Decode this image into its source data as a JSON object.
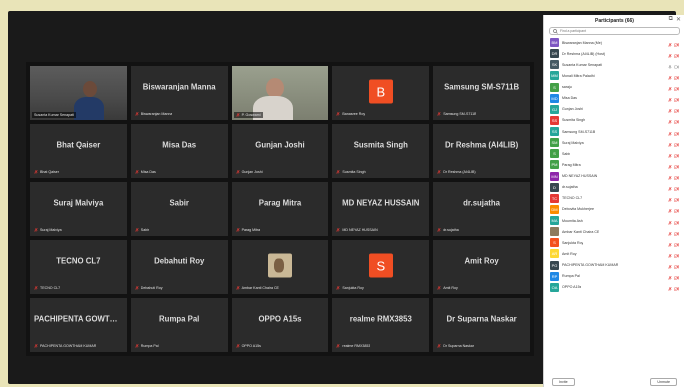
{
  "panel": {
    "title": "Participants (66)",
    "search_placeholder": "Find a participant",
    "invite_label": "Invite",
    "unmute_label": "Unmute",
    "participants": [
      {
        "initials": "BM",
        "color": "#7e57c2",
        "name": "Biswaranjan Manna (Me)",
        "mic": "muted",
        "video": "off"
      },
      {
        "initials": "DR",
        "color": "#37474f",
        "name": "Dr Reshma (AI4LIB) (Host)",
        "mic": "muted",
        "video": "off"
      },
      {
        "initials": "SK",
        "color": "#455a64",
        "name": "Susanta Kumar Senapati",
        "mic": "on",
        "video": "on"
      },
      {
        "initials": "MM",
        "color": "#26a69a",
        "name": "Monali Mitra Paladhi",
        "mic": "muted",
        "video": "off"
      },
      {
        "initials": "S",
        "color": "#43a047",
        "name": "saraju",
        "mic": "muted",
        "video": "off"
      },
      {
        "initials": "MD",
        "color": "#1e88e5",
        "name": "Misa Das",
        "mic": "muted",
        "video": "off"
      },
      {
        "initials": "GJ",
        "color": "#26a69a",
        "name": "Gunjan Joshi",
        "mic": "muted",
        "video": "off"
      },
      {
        "initials": "SS",
        "color": "#e53935",
        "name": "Susmita Singh",
        "mic": "muted",
        "video": "off"
      },
      {
        "initials": "SS",
        "color": "#26a69a",
        "name": "Samsung SM-S711B",
        "mic": "muted",
        "video": "off"
      },
      {
        "initials": "SM",
        "color": "#43a047",
        "name": "Suraj Malviya",
        "mic": "muted",
        "video": "off"
      },
      {
        "initials": "S",
        "color": "#43a047",
        "name": "Sabir",
        "mic": "muted",
        "video": "off"
      },
      {
        "initials": "PM",
        "color": "#43a047",
        "name": "Parag Mitra",
        "mic": "muted",
        "video": "off"
      },
      {
        "initials": "MN",
        "color": "#8e24aa",
        "name": "MD NEYAZ HUSSAIN",
        "mic": "muted",
        "video": "off"
      },
      {
        "initials": "D",
        "color": "#37474f",
        "name": "dr.sujatha",
        "mic": "muted",
        "video": "off"
      },
      {
        "initials": "TC",
        "color": "#e53935",
        "name": "TECNO CL7",
        "mic": "muted",
        "video": "off"
      },
      {
        "initials": "DM",
        "color": "#fb8c00",
        "name": "Debovita Mukherjee",
        "mic": "muted",
        "video": "off"
      },
      {
        "initials": "MA",
        "color": "#26a69a",
        "name": "Moumita Ash",
        "mic": "muted",
        "video": "off"
      },
      {
        "initials": "",
        "color": "#8d7b5e",
        "name": "Ambar Kanti Chaira CE",
        "mic": "muted",
        "video": "off"
      },
      {
        "initials": "S",
        "color": "#f4511e",
        "name": "Sanjukta Roy",
        "mic": "muted",
        "video": "off"
      },
      {
        "initials": "AR",
        "color": "#fdd835",
        "name": "Amit Roy",
        "mic": "muted",
        "video": "off"
      },
      {
        "initials": "PG",
        "color": "#37474f",
        "name": "PACHIPENTA GOWTHAM KUMAR",
        "mic": "muted",
        "video": "off"
      },
      {
        "initials": "RP",
        "color": "#1e88e5",
        "name": "Rumpa Pal",
        "mic": "muted",
        "video": "off"
      },
      {
        "initials": "OA",
        "color": "#26a69a",
        "name": "OPPO A15s",
        "mic": "muted",
        "video": "off"
      }
    ]
  },
  "tiles": [
    {
      "type": "video",
      "variant": "vid1",
      "display": "",
      "label": "Susanta Kumar Senapati",
      "muted": false
    },
    {
      "type": "name",
      "display": "Biswaranjan Manna",
      "label": "Biswaranjan Manna",
      "muted": true
    },
    {
      "type": "video",
      "variant": "vid2",
      "display": "",
      "label": "P. Goswami",
      "muted": true
    },
    {
      "type": "avatar",
      "letter": "B",
      "display": "",
      "label": "Banasree Roy",
      "muted": true
    },
    {
      "type": "name",
      "display": "Samsung SM-S711B",
      "label": "Samsung SM-S711B",
      "muted": true
    },
    {
      "type": "name",
      "display": "Bhat Qaiser",
      "label": "Bhat Qaiser",
      "muted": true
    },
    {
      "type": "name",
      "display": "Misa Das",
      "label": "Misa Das",
      "muted": true
    },
    {
      "type": "name",
      "display": "Gunjan Joshi",
      "label": "Gunjan Joshi",
      "muted": true
    },
    {
      "type": "name",
      "display": "Susmita Singh",
      "label": "Susmita Singh",
      "muted": true
    },
    {
      "type": "name",
      "display": "Dr Reshma (AI4LIB)",
      "label": "Dr Reshma (AI4LIB)",
      "muted": true
    },
    {
      "type": "name",
      "display": "Suraj Malviya",
      "label": "Suraj Malviya",
      "muted": true
    },
    {
      "type": "name",
      "display": "Sabir",
      "label": "Sabir",
      "muted": true
    },
    {
      "type": "name",
      "display": "Parag Mitra",
      "label": "Parag Mitra",
      "muted": true
    },
    {
      "type": "name",
      "display": "MD NEYAZ HUSSAIN",
      "label": "MD NEYAZ HUSSAIN",
      "muted": true
    },
    {
      "type": "name",
      "display": "dr.sujatha",
      "label": "dr.sujatha",
      "muted": true
    },
    {
      "type": "name",
      "display": "TECNO CL7",
      "label": "TECNO CL7",
      "muted": true
    },
    {
      "type": "name",
      "display": "Debahuti Roy",
      "label": "Debahuti Roy",
      "muted": true
    },
    {
      "type": "photo",
      "display": "",
      "label": "Ambar Kanti Chaira CE",
      "muted": true
    },
    {
      "type": "avatar",
      "letter": "S",
      "display": "",
      "label": "Sanjukta Roy",
      "muted": true
    },
    {
      "type": "name",
      "display": "Amit Roy",
      "label": "Amit Roy",
      "muted": true
    },
    {
      "type": "name",
      "display": "PACHIPENTA GOWTHAM K...",
      "label": "PACHIPENTA GOWTHAM KUMAR",
      "muted": true
    },
    {
      "type": "name",
      "display": "Rumpa Pal",
      "label": "Rumpa Pal",
      "muted": true
    },
    {
      "type": "name",
      "display": "OPPO A15s",
      "label": "OPPO A15s",
      "muted": true
    },
    {
      "type": "name",
      "display": "realme RMX3853",
      "label": "realme RMX3853",
      "muted": true
    },
    {
      "type": "name",
      "display": "Dr Suparna Naskar",
      "label": "Dr Suparna Naskar",
      "muted": true
    }
  ],
  "colors": {
    "mute_red": "#e53935",
    "active_speaker": "#00c853",
    "avatar_orange": "#f04e23"
  }
}
